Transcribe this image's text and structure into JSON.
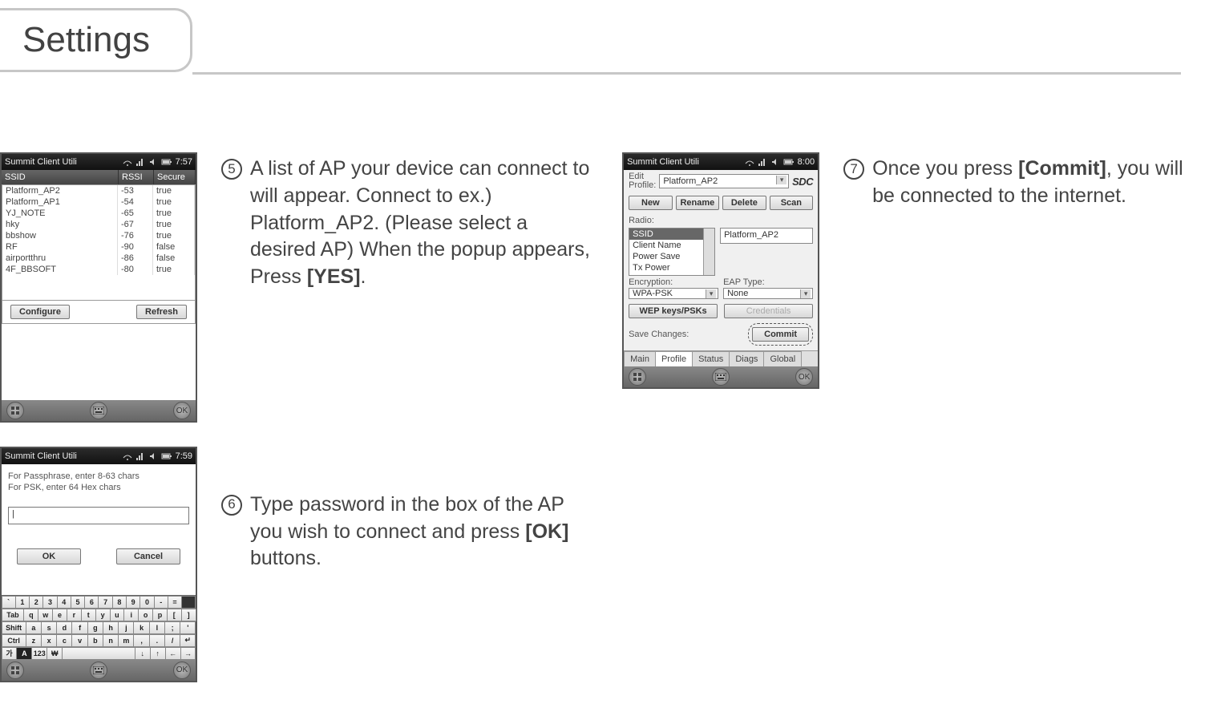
{
  "title": "Settings",
  "step5": {
    "num": "5",
    "text_1": "A list of AP your device can connect to will appear. Connect to ex.) Platform_AP2. (Please select a desired AP) When the popup appears, Press ",
    "bold": "[YES]",
    "tail": "."
  },
  "step6": {
    "num": "6",
    "text_1": "Type password in the box of the AP you wish to connect and press ",
    "bold": "[OK]",
    "tail": " buttons."
  },
  "step7": {
    "num": "7",
    "text_1": "Once you press ",
    "bold": "[Commit]",
    "tail": ", you will be connected to the internet."
  },
  "shot5": {
    "title": "Summit Client Utili",
    "time": "7:57",
    "headers": {
      "ssid": "SSID",
      "rssi": "RSSI",
      "secure": "Secure"
    },
    "rows": [
      {
        "ssid": "Platform_AP2",
        "rssi": "-53",
        "secure": "true"
      },
      {
        "ssid": "Platform_AP1",
        "rssi": "-54",
        "secure": "true"
      },
      {
        "ssid": "YJ_NOTE",
        "rssi": "-65",
        "secure": "true"
      },
      {
        "ssid": "hky",
        "rssi": "-67",
        "secure": "true"
      },
      {
        "ssid": "bbshow",
        "rssi": "-76",
        "secure": "true"
      },
      {
        "ssid": "RF",
        "rssi": "-90",
        "secure": "false"
      },
      {
        "ssid": "airportthru",
        "rssi": "-86",
        "secure": "false"
      },
      {
        "ssid": "4F_BBSOFT",
        "rssi": "-80",
        "secure": "true"
      }
    ],
    "configure": "Configure",
    "refresh": "Refresh",
    "ok": "OK"
  },
  "shot6": {
    "title": "Summit Client Utili",
    "time": "7:59",
    "msg1": "For Passphrase, enter 8-63 chars",
    "msg2": "For PSK, enter 64 Hex chars",
    "input_value": "|",
    "ok": "OK",
    "cancel": "Cancel",
    "kbd": {
      "r1": [
        "`",
        "1",
        "2",
        "3",
        "4",
        "5",
        "6",
        "7",
        "8",
        "9",
        "0",
        "-",
        "=",
        "⠀"
      ],
      "r2": [
        "Tab",
        "q",
        "w",
        "e",
        "r",
        "t",
        "y",
        "u",
        "i",
        "o",
        "p",
        "[",
        "]"
      ],
      "r3": [
        "Shift",
        "a",
        "s",
        "d",
        "f",
        "g",
        "h",
        "j",
        "k",
        "l",
        ";",
        "'"
      ],
      "r4": [
        "Ctrl",
        "z",
        "x",
        "c",
        "v",
        "b",
        "n",
        "m",
        ",",
        ".",
        "/",
        "↵"
      ],
      "r5": [
        "가",
        "A",
        "123",
        "₩",
        "",
        "↓",
        "↑",
        "←",
        "→"
      ]
    }
  },
  "shot7": {
    "title": "Summit Client Utili",
    "time": "8:00",
    "edit_profile_label": "Edit\nProfile:",
    "profile_value": "Platform_AP2",
    "sdc": "SDC",
    "new": "New",
    "rename": "Rename",
    "delete": "Delete",
    "scan": "Scan",
    "radio_label": "Radio:",
    "list": [
      "SSID",
      "Client Name",
      "Power Save",
      "Tx Power"
    ],
    "ssid_value": "Platform_AP2",
    "enc_label": "Encryption:",
    "enc_value": "WPA-PSK",
    "eap_label": "EAP Type:",
    "eap_value": "None",
    "wep": "WEP keys/PSKs",
    "cred": "Credentials",
    "save_label": "Save Changes:",
    "commit": "Commit",
    "tabs": [
      "Main",
      "Profile",
      "Status",
      "Diags",
      "Global"
    ],
    "ok": "OK"
  }
}
